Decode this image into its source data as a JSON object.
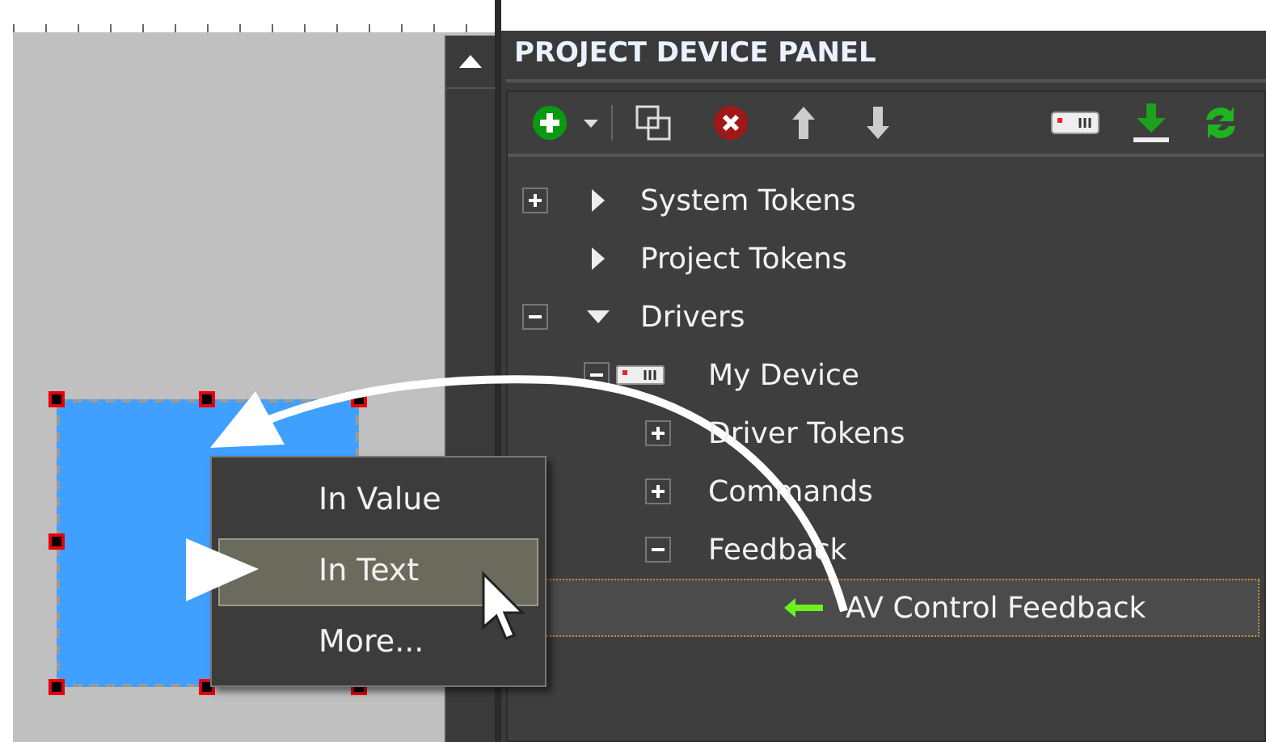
{
  "panel": {
    "title": "PROJECT DEVICE PANEL"
  },
  "tree": [
    {
      "label": "System Tokens",
      "kind": "category",
      "expandable": true,
      "expanded": false,
      "selected": false
    },
    {
      "label": "Project Tokens",
      "kind": "category",
      "expandable": false,
      "expanded": false,
      "selected": false
    },
    {
      "label": "Drivers",
      "kind": "category",
      "expandable": true,
      "expanded": true,
      "selected": false,
      "children": [
        {
          "label": "My Device",
          "kind": "device",
          "expandable": true,
          "expanded": true,
          "selected": false,
          "children": [
            {
              "label": "Driver Tokens",
              "kind": "group",
              "expandable": true,
              "expanded": false,
              "selected": false
            },
            {
              "label": "Commands",
              "kind": "group",
              "expandable": true,
              "expanded": false,
              "selected": false
            },
            {
              "label": "Feedback",
              "kind": "group",
              "expandable": true,
              "expanded": true,
              "selected": false,
              "children": [
                {
                  "label": "AV Control Feedback",
                  "kind": "feedback",
                  "expandable": false,
                  "expanded": false,
                  "selected": true
                }
              ]
            }
          ]
        }
      ]
    }
  ],
  "context_menu": [
    {
      "label": "In Value",
      "selected": false
    },
    {
      "label": "In Text",
      "selected": true
    },
    {
      "label": "More...",
      "selected": false
    }
  ]
}
